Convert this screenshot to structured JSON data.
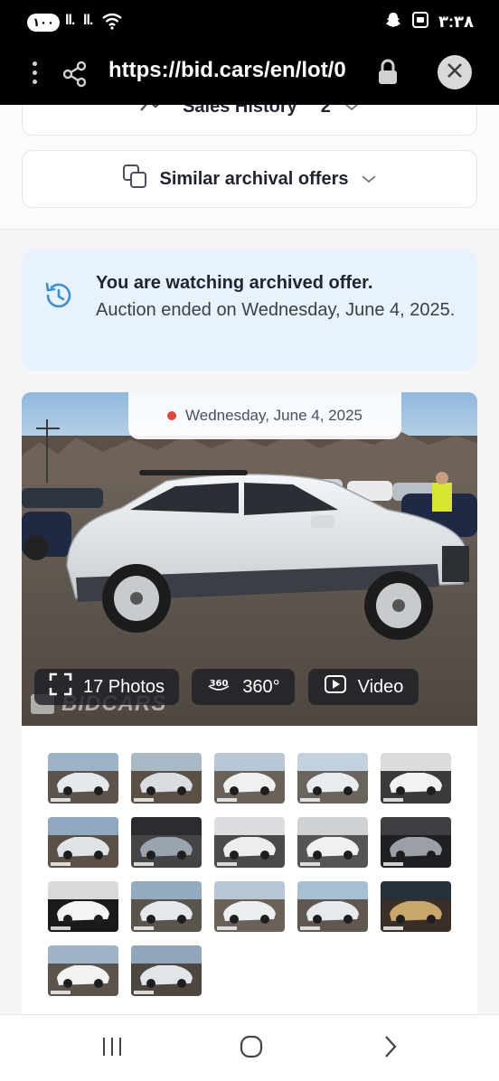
{
  "status_bar": {
    "battery": "١٠٠",
    "signal_1": "ll.",
    "signal_2": "ll.",
    "time": "٣:٣٨"
  },
  "browser": {
    "url": "https://bid.cars/en/lot/0"
  },
  "page": {
    "sales_history_label": "Sales History",
    "sales_history_count": "2",
    "similar_offers_label": "Similar archival offers",
    "notice_title": "You are watching archived offer.",
    "notice_body": "Auction ended on Wednesday, June 4, 2025.",
    "auction_date": "Wednesday, June 4, 2025",
    "photos_label": "17 Photos",
    "btn_360_label": "360°",
    "video_label": "Video",
    "watermark": "BIDCARS"
  },
  "icons": {
    "status": [
      "battery-icon",
      "signal-icon",
      "wifi-icon",
      "snapchat-icon",
      "screenshot-icon"
    ],
    "browser": [
      "menu-dots-icon",
      "share-icon",
      "lock-icon",
      "close-icon"
    ],
    "page": [
      "chart-icon",
      "chevron-down-icon",
      "copy-icon",
      "history-icon",
      "expand-icon",
      "360-icon",
      "play-icon"
    ],
    "nav": [
      "recent-apps-icon",
      "home-icon",
      "forward-icon"
    ]
  },
  "colors": {
    "accent_blue": "#3d8fd6",
    "notice_bg": "#e8f2fc",
    "live_dot": "#e5433a",
    "car_body": "#e9ecef"
  },
  "thumbnail_count": 17
}
